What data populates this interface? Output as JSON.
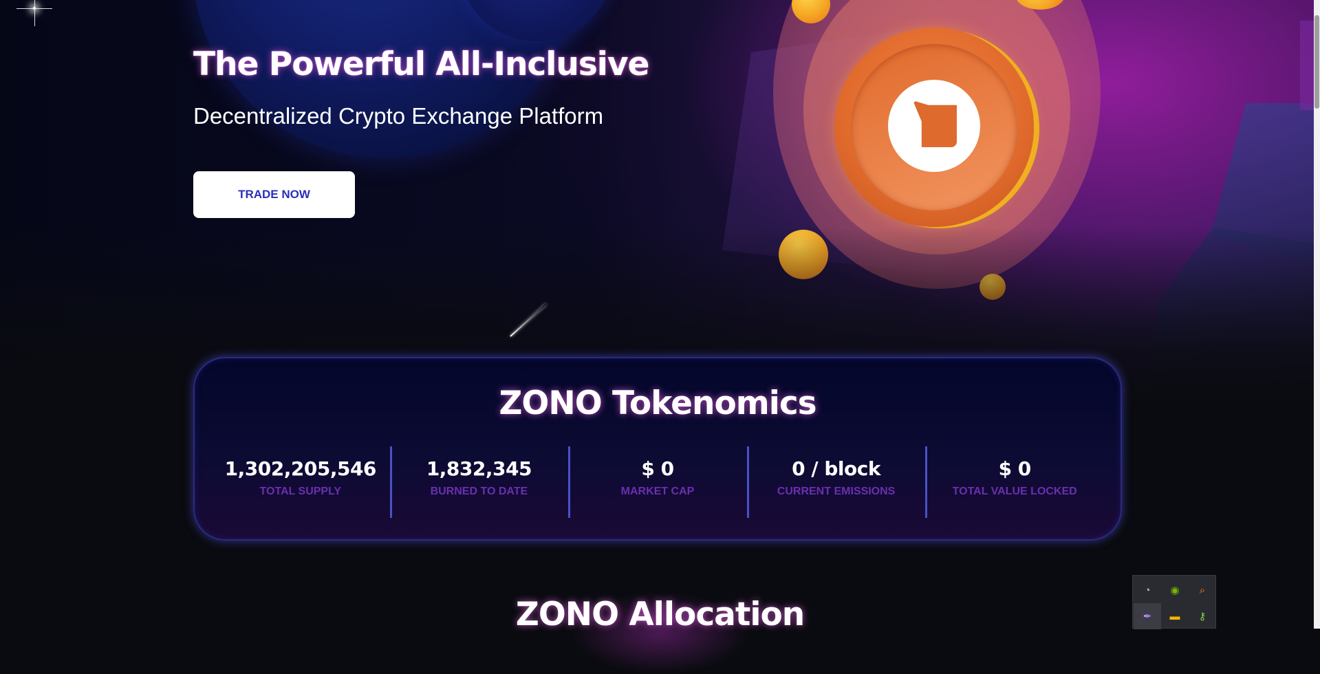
{
  "hero": {
    "title": "The Powerful All-Inclusive",
    "subtitle": "Decentralized Crypto Exchange Platform",
    "cta_label": "TRADE NOW"
  },
  "tokenomics": {
    "title": "ZONO Tokenomics",
    "stats": [
      {
        "value": "1,302,205,546",
        "label": "TOTAL SUPPLY"
      },
      {
        "value": "1,832,345",
        "label": "BURNED TO DATE"
      },
      {
        "value": "$ 0",
        "label": "MARKET CAP"
      },
      {
        "value": "0 / block",
        "label": "CURRENT EMISSIONS"
      },
      {
        "value": "$ 0",
        "label": "TOTAL VALUE LOCKED"
      }
    ]
  },
  "allocation": {
    "title": "ZONO Allocation"
  },
  "extensions": [
    {
      "icon": "eye-slash-icon",
      "glyph": "◔"
    },
    {
      "icon": "nvidia-icon",
      "glyph": "◉"
    },
    {
      "icon": "magnifier-icon",
      "glyph": "⌕"
    },
    {
      "icon": "feather-icon",
      "glyph": "✒"
    },
    {
      "icon": "folder-icon",
      "glyph": "▬"
    },
    {
      "icon": "key-icon",
      "glyph": "⚷"
    }
  ],
  "colors": {
    "accent_purple": "#6a2fb0",
    "cta_text": "#2a2fb8",
    "card_border": "#2b2a80",
    "divider": "#4a52c8",
    "coin_orange": "#e06a2c",
    "coin_ring": "#f0b020"
  }
}
